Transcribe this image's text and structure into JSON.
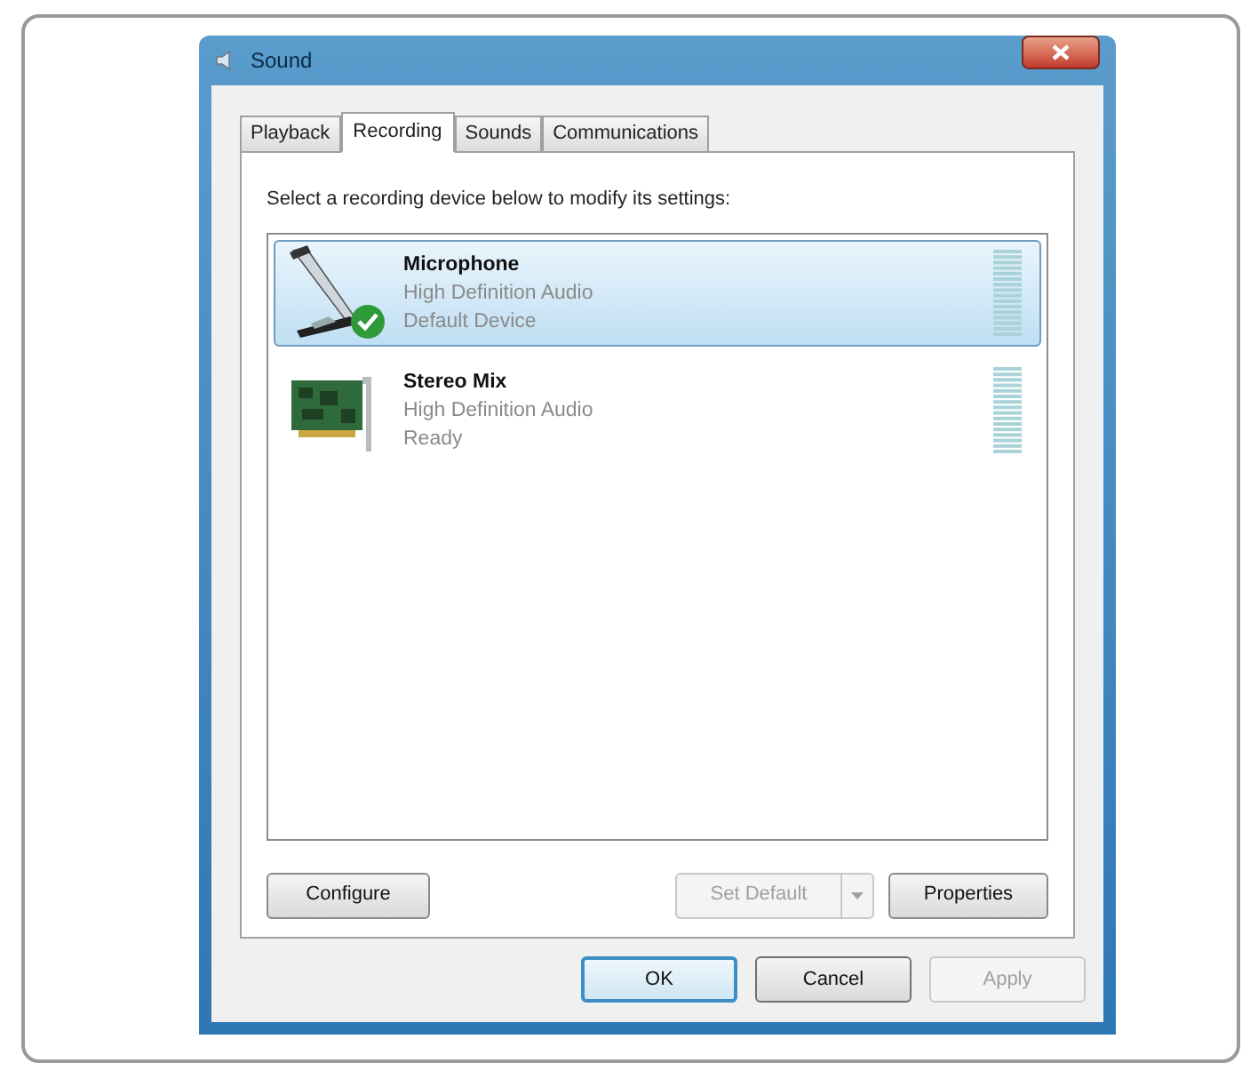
{
  "window": {
    "title": "Sound"
  },
  "tabs": [
    {
      "label": "Playback",
      "selected": false
    },
    {
      "label": "Recording",
      "selected": true
    },
    {
      "label": "Sounds",
      "selected": false
    },
    {
      "label": "Communications",
      "selected": false
    }
  ],
  "instruction": "Select a recording device below to modify its settings:",
  "devices": [
    {
      "kind": "microphone",
      "name": "Microphone",
      "driver": "High Definition Audio",
      "status": "Default Device",
      "selected": true,
      "default": true
    },
    {
      "kind": "sound-card",
      "name": "Stereo Mix",
      "driver": "High Definition Audio",
      "status": "Ready",
      "selected": false,
      "default": false
    }
  ],
  "device_buttons": [
    {
      "label": "Configure",
      "disabled": false,
      "split": false
    },
    {
      "label": "Set Default",
      "disabled": true,
      "split": true
    },
    {
      "label": "Properties",
      "disabled": false,
      "split": false
    }
  ],
  "dialog_buttons": [
    {
      "label": "OK",
      "disabled": false,
      "focused": true
    },
    {
      "label": "Cancel",
      "disabled": false,
      "focused": false
    },
    {
      "label": "Apply",
      "disabled": true,
      "focused": false
    }
  ]
}
